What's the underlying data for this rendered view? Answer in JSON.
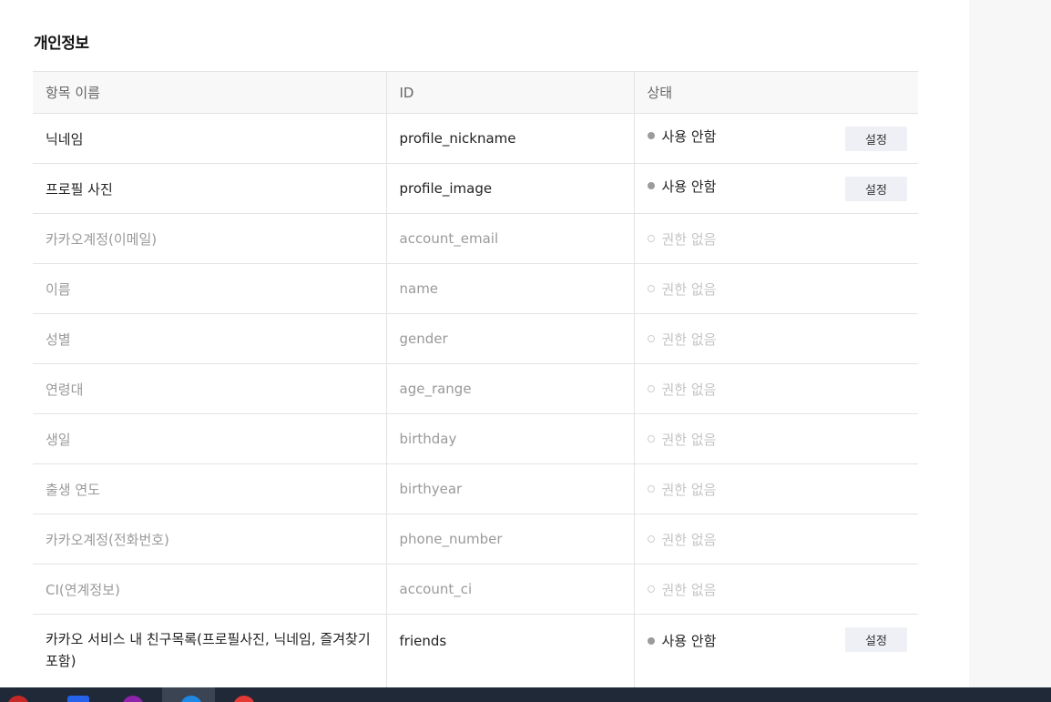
{
  "section_title": "개인정보",
  "columns": [
    "항목 이름",
    "ID",
    "상태"
  ],
  "rows": [
    {
      "name": "닉네임",
      "id": "profile_nickname",
      "status": "사용 안함",
      "state": "enabled",
      "action": "설정"
    },
    {
      "name": "프로필 사진",
      "id": "profile_image",
      "status": "사용 안함",
      "state": "enabled",
      "action": "설정"
    },
    {
      "name": "카카오계정(이메일)",
      "id": "account_email",
      "status": "권한 없음",
      "state": "disabled"
    },
    {
      "name": "이름",
      "id": "name",
      "status": "권한 없음",
      "state": "disabled"
    },
    {
      "name": "성별",
      "id": "gender",
      "status": "권한 없음",
      "state": "disabled"
    },
    {
      "name": "연령대",
      "id": "age_range",
      "status": "권한 없음",
      "state": "disabled"
    },
    {
      "name": "생일",
      "id": "birthday",
      "status": "권한 없음",
      "state": "disabled"
    },
    {
      "name": "출생 연도",
      "id": "birthyear",
      "status": "권한 없음",
      "state": "disabled"
    },
    {
      "name": "카카오계정(전화번호)",
      "id": "phone_number",
      "status": "권한 없음",
      "state": "disabled"
    },
    {
      "name": "CI(연계정보)",
      "id": "account_ci",
      "status": "권한 없음",
      "state": "disabled"
    },
    {
      "name": "카카오 서비스 내 친구목록(프로필사진, 닉네임, 즐겨찾기 포함)",
      "id": "friends",
      "status": "사용 안함",
      "state": "enabled",
      "action": "설정"
    }
  ],
  "colors": {
    "enabled_dot": "#9b9b9b",
    "disabled_dot": "#cfcfcf",
    "button_bg": "#eef0f5",
    "header_bg": "#f8f8f8",
    "taskbar_bg": "#1f2937"
  },
  "taskbar": {
    "icons": [
      "app-icon-red",
      "app-icon-blue",
      "app-icon-purple",
      "app-icon-edge",
      "app-icon-red-circle"
    ]
  }
}
